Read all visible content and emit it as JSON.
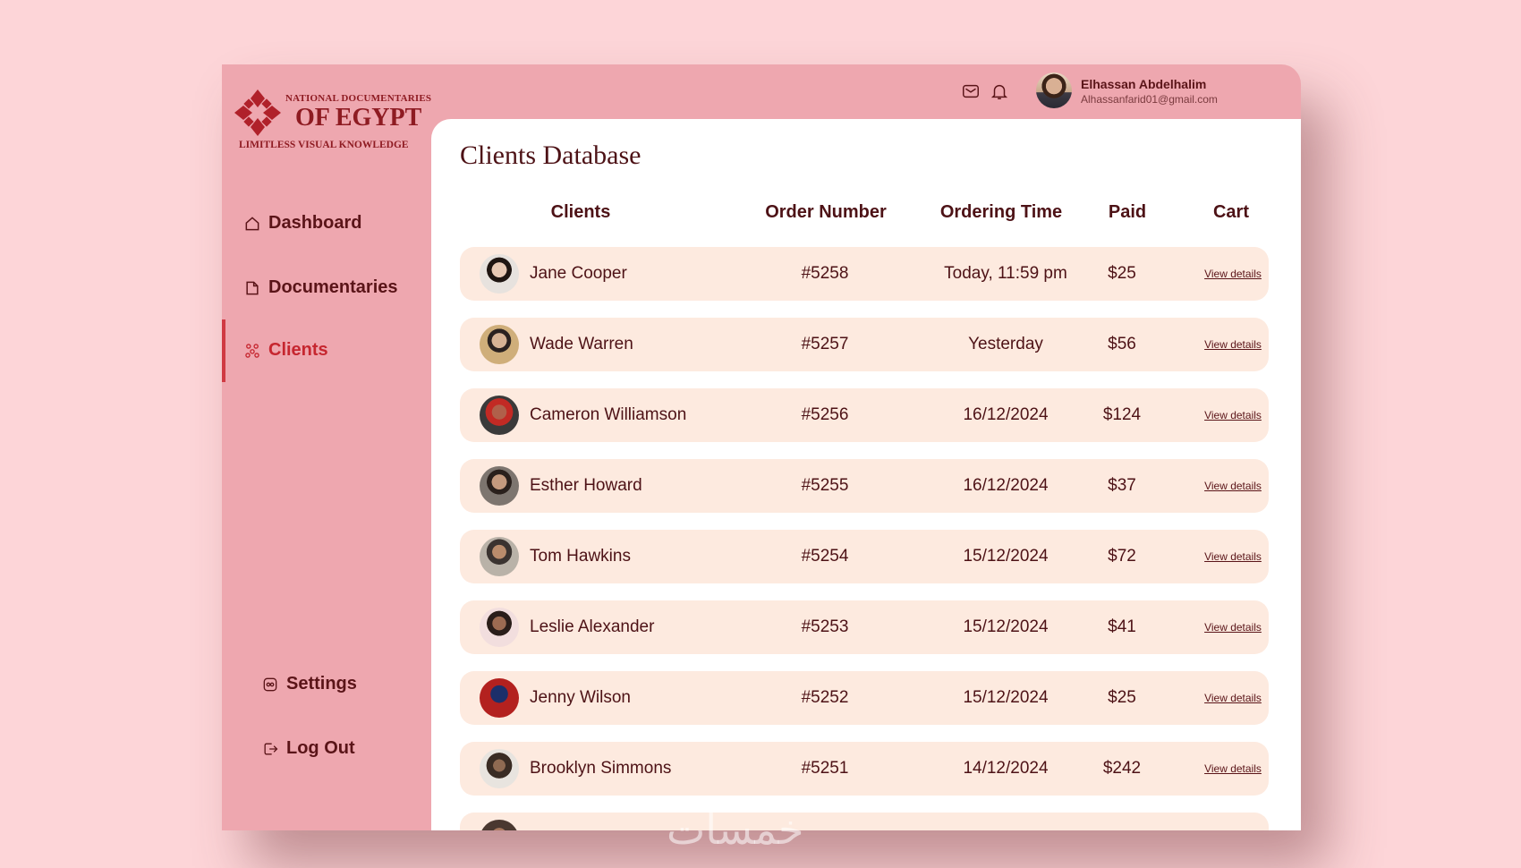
{
  "brand": {
    "line1": "NATIONAL DOCUMENTARIES",
    "line2": "OF EGYPT",
    "tagline": "LIMITLESS VISUAL KNOWLEDGE"
  },
  "topbar": {
    "icons": [
      "mail-icon",
      "bell-icon"
    ],
    "user": {
      "name": "Elhassan Abdelhalim",
      "email": "Alhassanfarid01@gmail.com"
    }
  },
  "sidebar": {
    "items": [
      {
        "label": "Dashboard",
        "icon": "home-icon",
        "active": false
      },
      {
        "label": "Documentaries",
        "icon": "folder-icon",
        "active": false
      },
      {
        "label": "Clients",
        "icon": "clients-icon",
        "active": true
      }
    ],
    "bottom": [
      {
        "label": "Settings",
        "icon": "settings-icon"
      },
      {
        "label": "Log Out",
        "icon": "logout-icon"
      }
    ]
  },
  "main": {
    "title": "Clients Database",
    "columns": [
      "Clients",
      "Order Number",
      "Ordering Time",
      "Paid",
      "Cart"
    ],
    "rows": [
      {
        "client": "Jane Cooper",
        "order": "#5258",
        "time": "Today, 11:59 pm",
        "paid": "$25",
        "cart": "View details"
      },
      {
        "client": "Wade Warren",
        "order": "#5257",
        "time": "Yesterday",
        "paid": "$56",
        "cart": "View details"
      },
      {
        "client": "Cameron Williamson",
        "order": "#5256",
        "time": "16/12/2024",
        "paid": "$124",
        "cart": "View details"
      },
      {
        "client": "Esther Howard",
        "order": "#5255",
        "time": "16/12/2024",
        "paid": "$37",
        "cart": "View details"
      },
      {
        "client": "Tom Hawkins",
        "order": "#5254",
        "time": "15/12/2024",
        "paid": "$72",
        "cart": "View details"
      },
      {
        "client": "Leslie Alexander",
        "order": "#5253",
        "time": "15/12/2024",
        "paid": "$41",
        "cart": "View details"
      },
      {
        "client": "Jenny Wilson",
        "order": "#5252",
        "time": "15/12/2024",
        "paid": "$25",
        "cart": "View details"
      },
      {
        "client": "Brooklyn Simmons",
        "order": "#5251",
        "time": "14/12/2024",
        "paid": "$242",
        "cart": "View details"
      }
    ]
  },
  "colors": {
    "page_bg": "#fdd5d8",
    "sidebar_bg": "#eea7af",
    "row_bg": "#fdeadf",
    "accent": "#c6262f",
    "text": "#4d1216"
  },
  "watermark": "خمسات"
}
